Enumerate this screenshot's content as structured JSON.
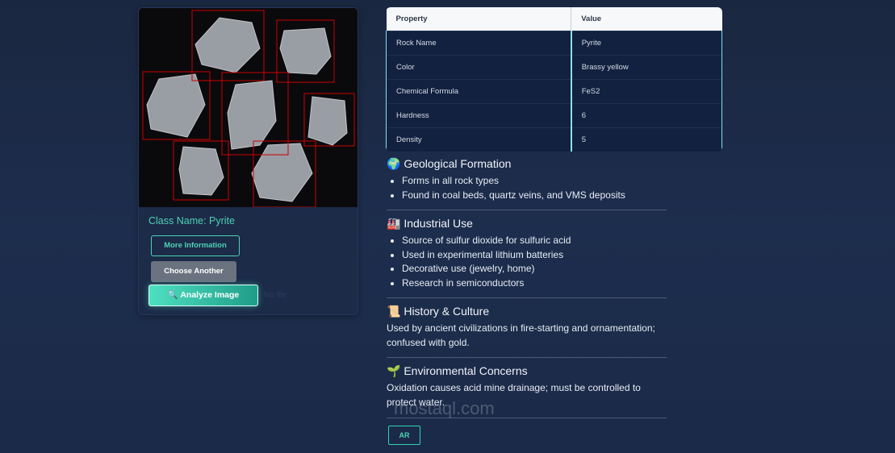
{
  "left": {
    "class_name": "Class Name: Pyrite",
    "more_info": "More Information",
    "choose_another": "Choose Another",
    "analyze": "Analyze Image",
    "analyze_icon": "magnifier-icon",
    "file_status": "No file"
  },
  "table": {
    "headers": [
      "Property",
      "Value"
    ],
    "rows": [
      [
        "Rock Name",
        "Pyrite"
      ],
      [
        "Color",
        "Brassy yellow"
      ],
      [
        "Chemical Formula",
        "FeS2"
      ],
      [
        "Hardness",
        "6"
      ],
      [
        "Density",
        "5"
      ]
    ]
  },
  "sections": {
    "geo": {
      "icon": "🌍",
      "title": "Geological Formation",
      "items": [
        "Forms in all rock types",
        "Found in coal beds, quartz veins, and VMS deposits"
      ]
    },
    "ind": {
      "icon": "🏭",
      "title": "Industrial Use",
      "items": [
        "Source of sulfur dioxide for sulfuric acid",
        "Used in experimental lithium batteries",
        "Decorative use (jewelry, home)",
        "Research in semiconductors"
      ]
    },
    "hist": {
      "icon": "📜",
      "title": "History & Culture",
      "text": "Used by ancient civilizations in fire-starting and ornamentation; confused with gold."
    },
    "env": {
      "icon": "🌱",
      "title": "Environmental Concerns",
      "text": "Oxidation causes acid mine drainage; must be controlled to protect water."
    }
  },
  "lang_button": "AR",
  "watermark": "mostaql.com",
  "colors": {
    "accent": "#4fd1b5",
    "background": "#1b2a48",
    "table_row": "#12213f"
  }
}
